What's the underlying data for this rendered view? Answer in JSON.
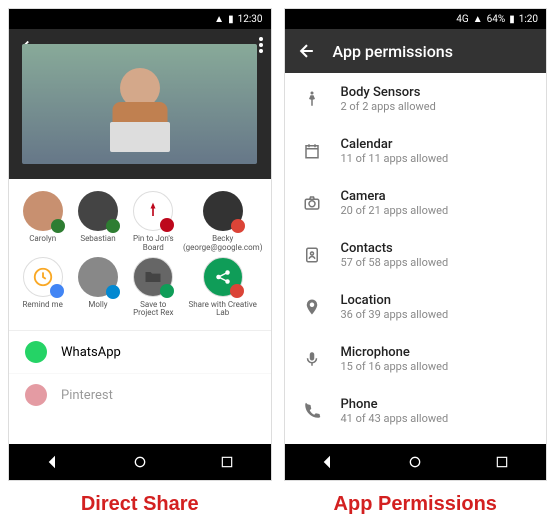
{
  "left": {
    "status": {
      "time": "12:30"
    },
    "share_targets_row1": [
      {
        "label": "Carolyn",
        "bg": "#c89070",
        "badge_bg": "#2e7d32"
      },
      {
        "label": "Sebastian",
        "bg": "#444",
        "badge_bg": "#2e7d32"
      },
      {
        "label": "Pin to Jon's Board",
        "bg": "#fff",
        "icon": "pin",
        "badge_bg": "#bd081c"
      },
      {
        "label": "Becky (george@google.com)",
        "bg": "#333",
        "badge_bg": "#db4437"
      }
    ],
    "share_targets_row2": [
      {
        "label": "Remind me",
        "bg": "#fff",
        "icon": "clock",
        "badge_bg": "#4285f4"
      },
      {
        "label": "Molly",
        "bg": "#888",
        "badge_bg": "#0288d1"
      },
      {
        "label": "Save to Project Rex",
        "bg": "#666",
        "icon": "folder",
        "badge_bg": "#0f9d58"
      },
      {
        "label": "Share with Creative Lab",
        "bg": "#0f9d58",
        "icon": "share",
        "badge_bg": "#db4437"
      }
    ],
    "apps": [
      {
        "name": "WhatsApp",
        "color": "#25d366"
      },
      {
        "name": "Pinterest",
        "color": "#bd081c"
      }
    ],
    "caption": "Direct Share"
  },
  "right": {
    "status": {
      "network": "4G",
      "battery": "64%",
      "time": "1:20"
    },
    "title": "App permissions",
    "permissions": [
      {
        "icon": "body",
        "title": "Body Sensors",
        "sub": "2 of 2 apps allowed"
      },
      {
        "icon": "calendar",
        "title": "Calendar",
        "sub": "11 of 11 apps allowed"
      },
      {
        "icon": "camera",
        "title": "Camera",
        "sub": "20 of 21 apps allowed"
      },
      {
        "icon": "contacts",
        "title": "Contacts",
        "sub": "57 of 58 apps allowed"
      },
      {
        "icon": "location",
        "title": "Location",
        "sub": "36 of 39 apps allowed"
      },
      {
        "icon": "mic",
        "title": "Microphone",
        "sub": "15 of 16 apps allowed"
      },
      {
        "icon": "phone",
        "title": "Phone",
        "sub": "41 of 43 apps allowed"
      }
    ],
    "caption": "App Permissions"
  }
}
